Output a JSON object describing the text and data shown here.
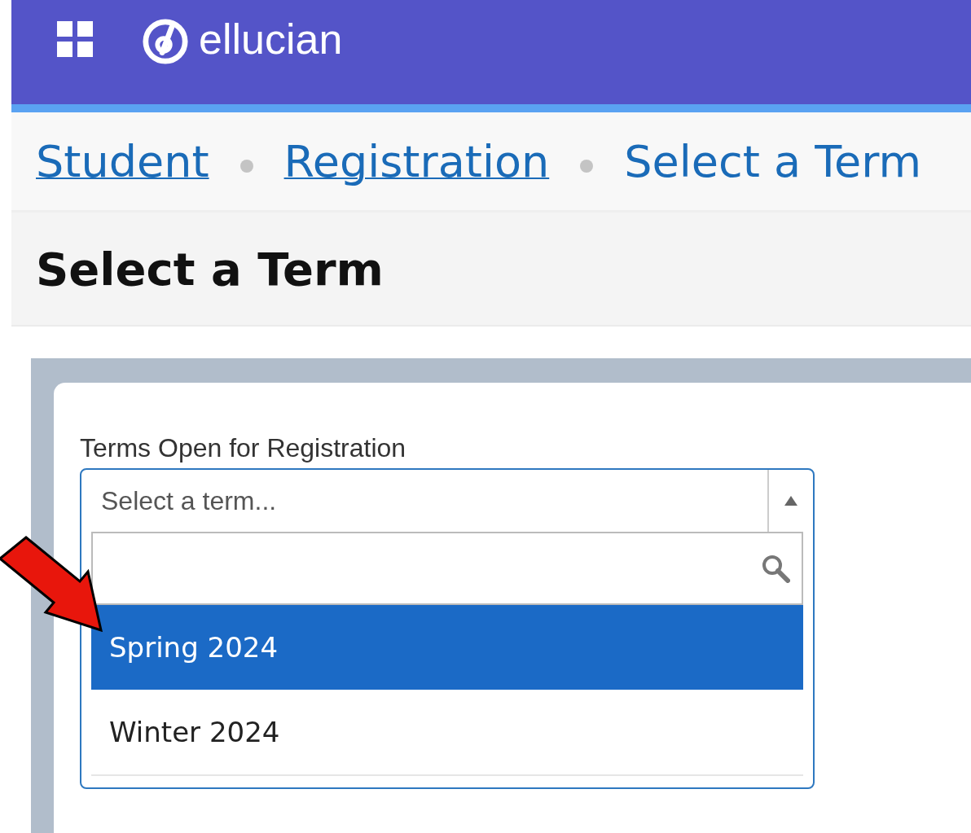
{
  "header": {
    "brand": "ellucian"
  },
  "breadcrumbs": [
    {
      "label": "Student",
      "kind": "link"
    },
    {
      "label": "Registration",
      "kind": "link"
    },
    {
      "label": "Select a Term",
      "kind": "current"
    }
  ],
  "page_title": "Select a Term",
  "term_select": {
    "label": "Terms Open for Registration",
    "placeholder": "Select a term...",
    "expanded": true,
    "options": [
      {
        "label": "Spring 2024",
        "selected": true
      },
      {
        "label": "Winter 2024",
        "selected": false
      }
    ]
  }
}
